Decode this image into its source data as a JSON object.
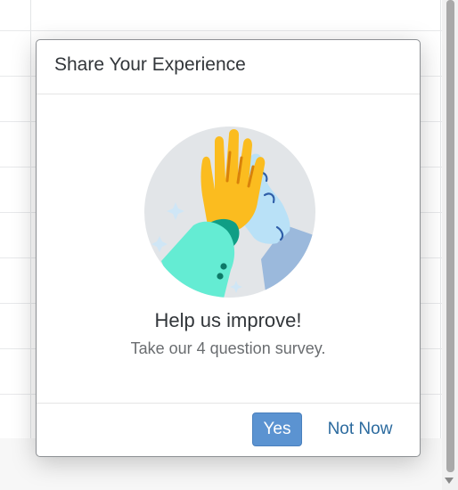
{
  "dialog": {
    "title": "Share Your Experience",
    "headline": "Help us improve!",
    "subtext": "Take our 4 question survey.",
    "illustration_icon": "high-five-illustration",
    "buttons": {
      "yes_label": "Yes",
      "not_now_label": "Not Now"
    }
  },
  "colors": {
    "primary_button": "#5b93d1",
    "link_button": "#2b6a9e",
    "hand_yellow": "#fbbc1f",
    "hand_blue": "#b9e1f7",
    "sleeve_teal": "#64ecd3",
    "circle_bg": "#e2e5e8"
  }
}
